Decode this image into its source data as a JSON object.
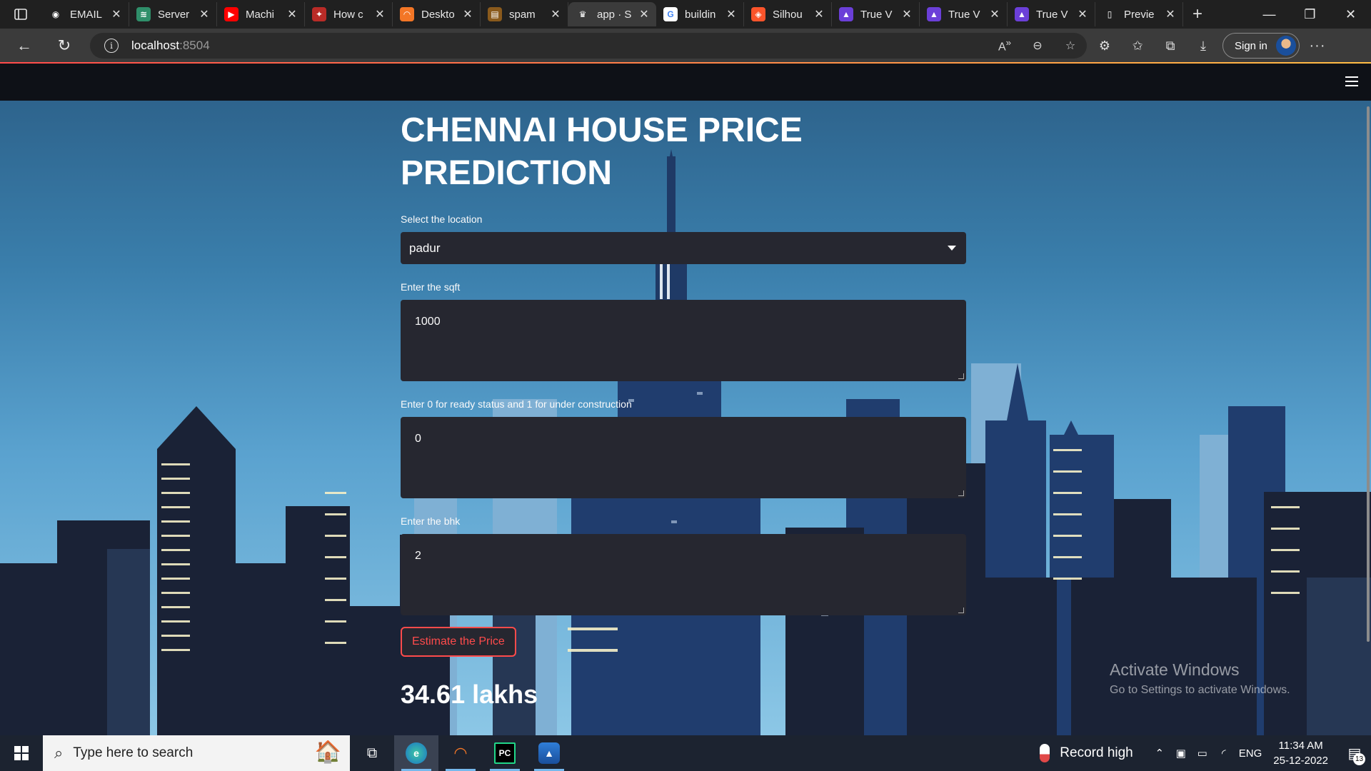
{
  "browser": {
    "tabs": [
      {
        "label": "EMAIL",
        "icon": "github-icon",
        "icon_bg": "#202020",
        "icon_glyph": "◉",
        "active": false
      },
      {
        "label": "Server",
        "icon": "server-icon",
        "icon_bg": "#2f8f6a",
        "icon_glyph": "≋",
        "active": false
      },
      {
        "label": "Machi",
        "icon": "youtube-icon",
        "icon_bg": "#ff0000",
        "icon_glyph": "▶",
        "active": false
      },
      {
        "label": "How c",
        "icon": "quora-icon",
        "icon_bg": "#b92b27",
        "icon_glyph": "✦",
        "active": false
      },
      {
        "label": "Deskto",
        "icon": "jupyter-icon",
        "icon_bg": "#f37626",
        "icon_glyph": "◠",
        "active": false
      },
      {
        "label": "spam",
        "icon": "kaggle-icon",
        "icon_bg": "#8a5a1c",
        "icon_glyph": "▤",
        "active": false
      },
      {
        "label": "app · S",
        "icon": "streamlit-icon",
        "icon_bg": "#3b3b3b",
        "icon_glyph": "♛",
        "active": true
      },
      {
        "label": "buildin",
        "icon": "google-icon",
        "icon_bg": "#ffffff",
        "icon_glyph": "G",
        "active": false
      },
      {
        "label": "Silhou",
        "icon": "brave-icon",
        "icon_bg": "#fb542b",
        "icon_glyph": "◈",
        "active": false
      },
      {
        "label": "True V",
        "icon": "truevector-icon",
        "icon_bg": "#6b3fd8",
        "icon_glyph": "▲",
        "active": false
      },
      {
        "label": "True V",
        "icon": "truevector-icon",
        "icon_bg": "#6b3fd8",
        "icon_glyph": "▲",
        "active": false
      },
      {
        "label": "True V",
        "icon": "truevector-icon",
        "icon_bg": "#6b3fd8",
        "icon_glyph": "▲",
        "active": false
      },
      {
        "label": "Previe",
        "icon": "page-icon",
        "icon_bg": "#202020",
        "icon_glyph": "▯",
        "active": false
      }
    ],
    "url_host": "localhost",
    "url_port": ":8504",
    "sign_in": "Sign in"
  },
  "app": {
    "title": "CHENNAI HOUSE PRICE PREDICTION",
    "location_label": "Select the location",
    "location_value": "padur",
    "sqft_label": "Enter the sqft",
    "sqft_value": "1000",
    "status_label": "Enter 0 for ready status and 1 for under construction",
    "status_value": "0",
    "bhk_label": "Enter the bhk",
    "bhk_value": "2",
    "button_label": "Estimate the Price",
    "result": "34.61 lakhs",
    "accent_color": "#ff4b4b",
    "input_bg": "#262730",
    "header_bg": "#0e1117"
  },
  "watermark": {
    "line1": "Activate Windows",
    "line2": "Go to Settings to activate Windows."
  },
  "taskbar": {
    "search_placeholder": "Type here to search",
    "weather_text": "Record high",
    "lang": "ENG",
    "time": "11:34 AM",
    "date": "25-12-2022",
    "notification_count": "13"
  }
}
